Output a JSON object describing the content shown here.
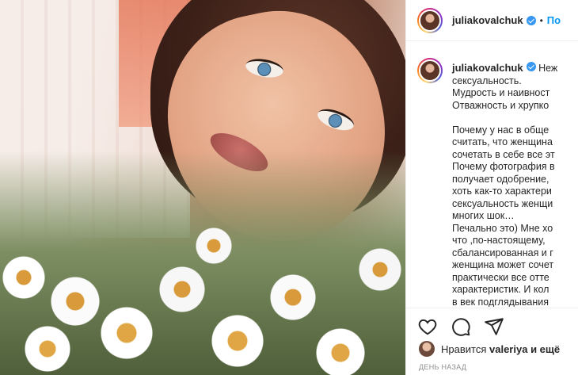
{
  "post": {
    "username": "juliakovalchuk",
    "follow_separator": "•",
    "follow_label": "По",
    "caption": {
      "username": "juliakovalchuk",
      "line1": "Неж",
      "line2": "сексуальность.",
      "line3": "Мудрость и наивност",
      "line4": "Отважность и хрупко",
      "line5": "Почему у нас в обще",
      "line6": "считать, что женщина",
      "line7": "сочетать в себе все эт",
      "line8": "Почему фотография в",
      "line9": "получает одобрение,",
      "line10": "хоть как-то характери",
      "line11": "сексуальность женщи",
      "line12": "многих шок…",
      "line13": "Печально это) Мне хо",
      "line14": "что ,по-настоящему,",
      "line15": "сбалансированная и г",
      "line16": "женщина может сочет",
      "line17": "практически все отте",
      "line18": "характеристик. И кол",
      "line19": "в век подглядывания"
    },
    "icons": {
      "like": "heart-icon",
      "comment": "comment-icon",
      "share": "paper-plane-icon"
    },
    "likes": {
      "prefix": "Нравится",
      "user": "valeriya",
      "suffix": "и ещё"
    },
    "timestamp": "ДЕНЬ НАЗАД"
  },
  "colors": {
    "link_blue": "#0095f6",
    "verified_blue": "#3897f0",
    "muted": "#8e8e8e",
    "text": "#262626"
  }
}
